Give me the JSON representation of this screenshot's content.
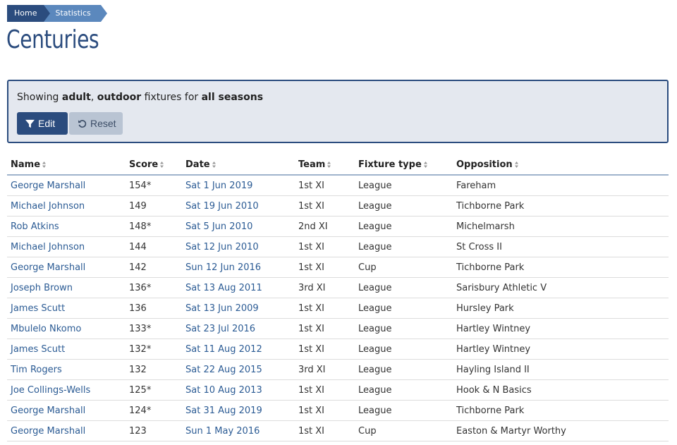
{
  "breadcrumb": {
    "home": "Home",
    "current": "Statistics"
  },
  "page": {
    "title": "Centuries"
  },
  "filter": {
    "prefix": "Showing ",
    "age": "adult",
    "sep": ", ",
    "venue": "outdoor",
    "middle": " fixtures for ",
    "season": "all seasons",
    "edit_label": "Edit",
    "reset_label": "Reset"
  },
  "table": {
    "headers": [
      "Name",
      "Score",
      "Date",
      "Team",
      "Fixture type",
      "Opposition"
    ],
    "rows": [
      [
        "George Marshall",
        "154*",
        "Sat 1 Jun 2019",
        "1st XI",
        "League",
        "Fareham"
      ],
      [
        "Michael Johnson",
        "149",
        "Sat 19 Jun 2010",
        "1st XI",
        "League",
        "Tichborne Park"
      ],
      [
        "Rob Atkins",
        "148*",
        "Sat 5 Jun 2010",
        "2nd XI",
        "League",
        "Michelmarsh"
      ],
      [
        "Michael Johnson",
        "144",
        "Sat 12 Jun 2010",
        "1st XI",
        "League",
        "St Cross II"
      ],
      [
        "George Marshall",
        "142",
        "Sun 12 Jun 2016",
        "1st XI",
        "Cup",
        "Tichborne Park"
      ],
      [
        "Joseph Brown",
        "136*",
        "Sat 13 Aug 2011",
        "3rd XI",
        "League",
        "Sarisbury Athletic V"
      ],
      [
        "James Scutt",
        "136",
        "Sat 13 Jun 2009",
        "1st XI",
        "League",
        "Hursley Park"
      ],
      [
        "Mbulelo Nkomo",
        "133*",
        "Sat 23 Jul 2016",
        "1st XI",
        "League",
        "Hartley Wintney"
      ],
      [
        "James Scutt",
        "132*",
        "Sat 11 Aug 2012",
        "1st XI",
        "League",
        "Hartley Wintney"
      ],
      [
        "Tim Rogers",
        "132",
        "Sat 22 Aug 2015",
        "3rd XI",
        "League",
        "Hayling Island II"
      ],
      [
        "Joe Collings-Wells",
        "125*",
        "Sat 10 Aug 2013",
        "1st XI",
        "League",
        "Hook & N Basics"
      ],
      [
        "George Marshall",
        "124*",
        "Sat 31 Aug 2019",
        "1st XI",
        "League",
        "Tichborne Park"
      ],
      [
        "George Marshall",
        "123",
        "Sun 1 May 2016",
        "1st XI",
        "Cup",
        "Easton & Martyr Worthy"
      ]
    ]
  },
  "colors": {
    "primary": "#2b4c7e",
    "breadcrumb_secondary": "#5b88bd",
    "link": "#2b5b94",
    "filter_bg": "#e4e8ef",
    "reset_bg": "#b9c4d3"
  },
  "icons": {
    "edit": "filter-icon",
    "reset": "undo-icon",
    "sort": "sort-icon"
  }
}
